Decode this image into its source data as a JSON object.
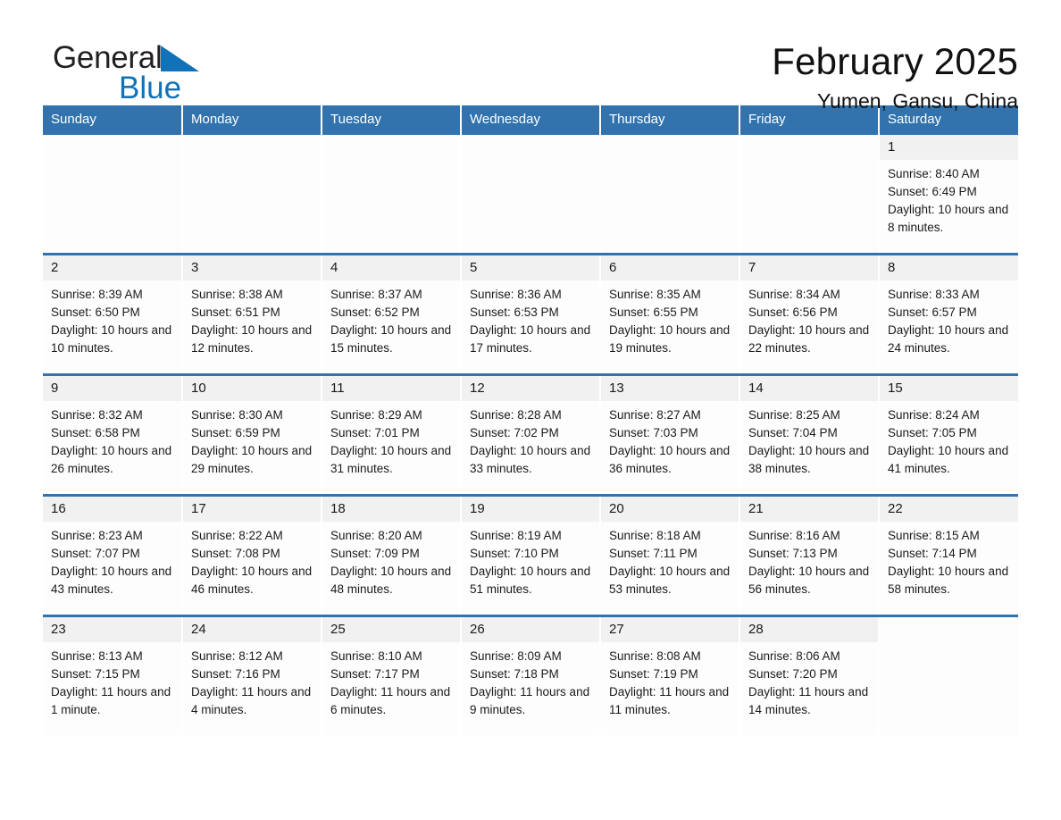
{
  "brand": {
    "name_top": "General",
    "name_bottom": "Blue",
    "triangle_color": "#1072b8",
    "text_color": "#231f20"
  },
  "header": {
    "month_title": "February 2025",
    "location": "Yumen, Gansu, China"
  },
  "colors": {
    "header_blue": "#3273ae",
    "row_divider_blue": "#3273ae",
    "daynum_band": "#f1f1f1",
    "cell_background": "#fdfdfd",
    "page_background": "#ffffff"
  },
  "weekdays": [
    "Sunday",
    "Monday",
    "Tuesday",
    "Wednesday",
    "Thursday",
    "Friday",
    "Saturday"
  ],
  "weeks": [
    [
      {
        "day": "",
        "blank": true
      },
      {
        "day": "",
        "blank": true
      },
      {
        "day": "",
        "blank": true
      },
      {
        "day": "",
        "blank": true
      },
      {
        "day": "",
        "blank": true
      },
      {
        "day": "",
        "blank": true
      },
      {
        "day": "1",
        "sunrise": "Sunrise: 8:40 AM",
        "sunset": "Sunset: 6:49 PM",
        "daylight": "Daylight: 10 hours and 8 minutes."
      }
    ],
    [
      {
        "day": "2",
        "sunrise": "Sunrise: 8:39 AM",
        "sunset": "Sunset: 6:50 PM",
        "daylight": "Daylight: 10 hours and 10 minutes."
      },
      {
        "day": "3",
        "sunrise": "Sunrise: 8:38 AM",
        "sunset": "Sunset: 6:51 PM",
        "daylight": "Daylight: 10 hours and 12 minutes."
      },
      {
        "day": "4",
        "sunrise": "Sunrise: 8:37 AM",
        "sunset": "Sunset: 6:52 PM",
        "daylight": "Daylight: 10 hours and 15 minutes."
      },
      {
        "day": "5",
        "sunrise": "Sunrise: 8:36 AM",
        "sunset": "Sunset: 6:53 PM",
        "daylight": "Daylight: 10 hours and 17 minutes."
      },
      {
        "day": "6",
        "sunrise": "Sunrise: 8:35 AM",
        "sunset": "Sunset: 6:55 PM",
        "daylight": "Daylight: 10 hours and 19 minutes."
      },
      {
        "day": "7",
        "sunrise": "Sunrise: 8:34 AM",
        "sunset": "Sunset: 6:56 PM",
        "daylight": "Daylight: 10 hours and 22 minutes."
      },
      {
        "day": "8",
        "sunrise": "Sunrise: 8:33 AM",
        "sunset": "Sunset: 6:57 PM",
        "daylight": "Daylight: 10 hours and 24 minutes."
      }
    ],
    [
      {
        "day": "9",
        "sunrise": "Sunrise: 8:32 AM",
        "sunset": "Sunset: 6:58 PM",
        "daylight": "Daylight: 10 hours and 26 minutes."
      },
      {
        "day": "10",
        "sunrise": "Sunrise: 8:30 AM",
        "sunset": "Sunset: 6:59 PM",
        "daylight": "Daylight: 10 hours and 29 minutes."
      },
      {
        "day": "11",
        "sunrise": "Sunrise: 8:29 AM",
        "sunset": "Sunset: 7:01 PM",
        "daylight": "Daylight: 10 hours and 31 minutes."
      },
      {
        "day": "12",
        "sunrise": "Sunrise: 8:28 AM",
        "sunset": "Sunset: 7:02 PM",
        "daylight": "Daylight: 10 hours and 33 minutes."
      },
      {
        "day": "13",
        "sunrise": "Sunrise: 8:27 AM",
        "sunset": "Sunset: 7:03 PM",
        "daylight": "Daylight: 10 hours and 36 minutes."
      },
      {
        "day": "14",
        "sunrise": "Sunrise: 8:25 AM",
        "sunset": "Sunset: 7:04 PM",
        "daylight": "Daylight: 10 hours and 38 minutes."
      },
      {
        "day": "15",
        "sunrise": "Sunrise: 8:24 AM",
        "sunset": "Sunset: 7:05 PM",
        "daylight": "Daylight: 10 hours and 41 minutes."
      }
    ],
    [
      {
        "day": "16",
        "sunrise": "Sunrise: 8:23 AM",
        "sunset": "Sunset: 7:07 PM",
        "daylight": "Daylight: 10 hours and 43 minutes."
      },
      {
        "day": "17",
        "sunrise": "Sunrise: 8:22 AM",
        "sunset": "Sunset: 7:08 PM",
        "daylight": "Daylight: 10 hours and 46 minutes."
      },
      {
        "day": "18",
        "sunrise": "Sunrise: 8:20 AM",
        "sunset": "Sunset: 7:09 PM",
        "daylight": "Daylight: 10 hours and 48 minutes."
      },
      {
        "day": "19",
        "sunrise": "Sunrise: 8:19 AM",
        "sunset": "Sunset: 7:10 PM",
        "daylight": "Daylight: 10 hours and 51 minutes."
      },
      {
        "day": "20",
        "sunrise": "Sunrise: 8:18 AM",
        "sunset": "Sunset: 7:11 PM",
        "daylight": "Daylight: 10 hours and 53 minutes."
      },
      {
        "day": "21",
        "sunrise": "Sunrise: 8:16 AM",
        "sunset": "Sunset: 7:13 PM",
        "daylight": "Daylight: 10 hours and 56 minutes."
      },
      {
        "day": "22",
        "sunrise": "Sunrise: 8:15 AM",
        "sunset": "Sunset: 7:14 PM",
        "daylight": "Daylight: 10 hours and 58 minutes."
      }
    ],
    [
      {
        "day": "23",
        "sunrise": "Sunrise: 8:13 AM",
        "sunset": "Sunset: 7:15 PM",
        "daylight": "Daylight: 11 hours and 1 minute."
      },
      {
        "day": "24",
        "sunrise": "Sunrise: 8:12 AM",
        "sunset": "Sunset: 7:16 PM",
        "daylight": "Daylight: 11 hours and 4 minutes."
      },
      {
        "day": "25",
        "sunrise": "Sunrise: 8:10 AM",
        "sunset": "Sunset: 7:17 PM",
        "daylight": "Daylight: 11 hours and 6 minutes."
      },
      {
        "day": "26",
        "sunrise": "Sunrise: 8:09 AM",
        "sunset": "Sunset: 7:18 PM",
        "daylight": "Daylight: 11 hours and 9 minutes."
      },
      {
        "day": "27",
        "sunrise": "Sunrise: 8:08 AM",
        "sunset": "Sunset: 7:19 PM",
        "daylight": "Daylight: 11 hours and 11 minutes."
      },
      {
        "day": "28",
        "sunrise": "Sunrise: 8:06 AM",
        "sunset": "Sunset: 7:20 PM",
        "daylight": "Daylight: 11 hours and 14 minutes."
      },
      {
        "day": "",
        "blank": true
      }
    ]
  ]
}
